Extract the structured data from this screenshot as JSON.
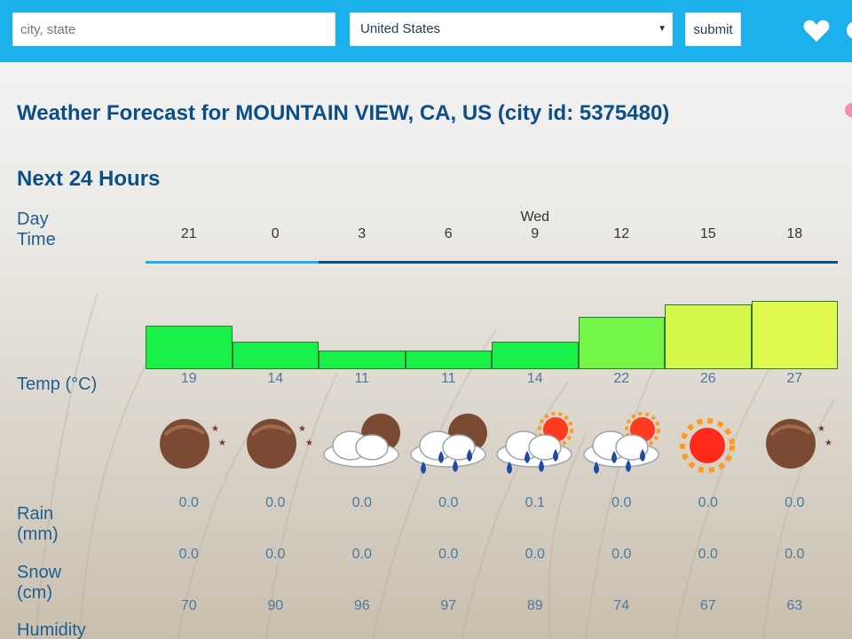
{
  "header": {
    "search_placeholder": "city, state",
    "country_selected": "United States",
    "submit_label": "submit",
    "bg_color": "#1cb0ec"
  },
  "page": {
    "title": "Weather Forecast for MOUNTAIN VIEW, CA, US (city id: 5375480)",
    "section_title": "Next 24 Hours"
  },
  "labels": {
    "day": "Day",
    "time": "Time",
    "temp": "Temp (°C)",
    "rain_1": "Rain",
    "rain_2": "(mm)",
    "snow_1": "Snow",
    "snow_2": "(cm)",
    "humidity": "Humidity"
  },
  "forecast": {
    "days": [
      "",
      "",
      "",
      "",
      "Wed",
      "",
      "",
      ""
    ],
    "times": [
      "21",
      "0",
      "3",
      "6",
      "9",
      "12",
      "15",
      "18"
    ],
    "temps": [
      "19",
      "14",
      "11",
      "11",
      "14",
      "22",
      "26",
      "27"
    ],
    "bar_colors": [
      "#19f04a",
      "#19f04a",
      "#19f04a",
      "#19f04a",
      "#19f04a",
      "#75f548",
      "#d4f94a",
      "#dff94e"
    ],
    "icons": [
      "moon-clear-icon",
      "moon-clear-icon",
      "cloudy-night-icon",
      "rain-night-icon",
      "rain-day-icon",
      "rain-day-icon",
      "sun-icon",
      "moon-clear-icon"
    ],
    "rain": [
      "0.0",
      "0.0",
      "0.0",
      "0.0",
      "0.1",
      "0.0",
      "0.0",
      "0.0"
    ],
    "snow": [
      "0.0",
      "0.0",
      "0.0",
      "0.0",
      "0.0",
      "0.0",
      "0.0",
      "0.0"
    ],
    "humidity": [
      "70",
      "90",
      "96",
      "97",
      "89",
      "74",
      "67",
      "63"
    ],
    "timeline_progress_fraction": 0.25
  }
}
